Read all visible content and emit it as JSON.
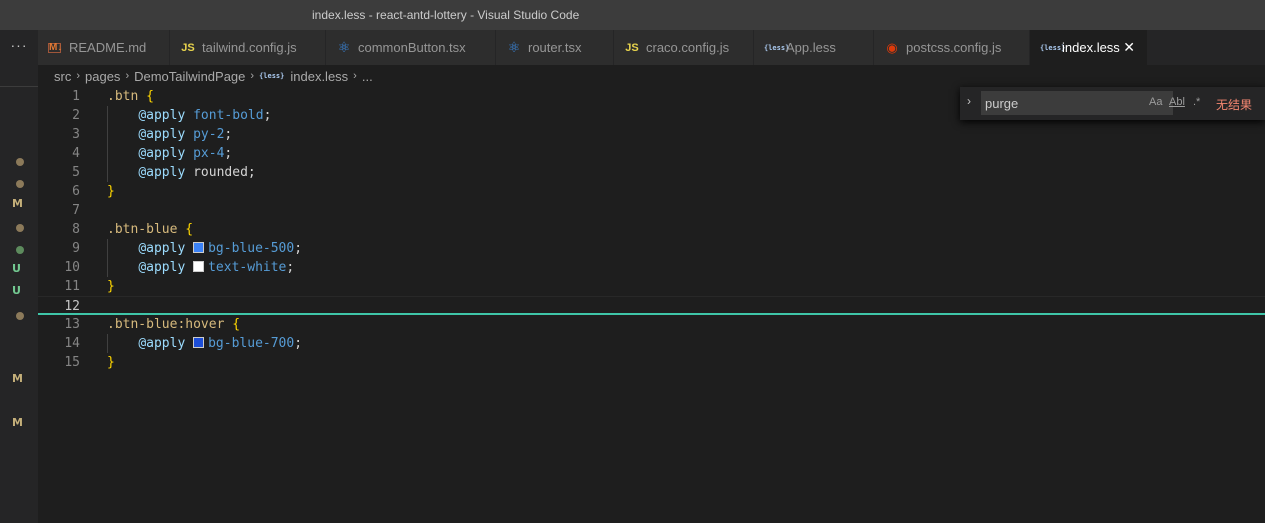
{
  "window": {
    "title": "index.less - react-antd-lottery - Visual Studio Code"
  },
  "tabbar": {
    "more_label": "···",
    "tabs": [
      {
        "label": "README.md",
        "icon": "markdown-icon",
        "icon_text": "M↓",
        "active": false
      },
      {
        "label": "tailwind.config.js",
        "icon": "javascript-icon",
        "icon_text": "JS",
        "active": false
      },
      {
        "label": "commonButton.tsx",
        "icon": "react-icon",
        "icon_text": "⚛",
        "active": false
      },
      {
        "label": "router.tsx",
        "icon": "react-icon",
        "icon_text": "⚛",
        "active": false
      },
      {
        "label": "craco.config.js",
        "icon": "javascript-icon",
        "icon_text": "JS",
        "active": false
      },
      {
        "label": "App.less",
        "icon": "less-icon",
        "icon_text": "{less}",
        "active": false
      },
      {
        "label": "postcss.config.js",
        "icon": "postcss-icon",
        "icon_text": "◉",
        "active": false
      },
      {
        "label": "index.less",
        "icon": "less-icon",
        "icon_text": "{less}",
        "active": true,
        "close": "✕"
      }
    ]
  },
  "breadcrumb": {
    "items": [
      "src",
      "pages",
      "DemoTailwindPage",
      "index.less",
      "..."
    ],
    "less_icon_text": "{less}",
    "separator": "›"
  },
  "sidebar_markers": [
    {
      "type": "dot",
      "label": ""
    },
    {
      "type": "dot",
      "label": ""
    },
    {
      "type": "letter",
      "label": "M"
    },
    {
      "type": "dot",
      "label": ""
    },
    {
      "type": "dotg",
      "label": ""
    },
    {
      "type": "letter",
      "label": "U"
    },
    {
      "type": "letter",
      "label": "U"
    },
    {
      "type": "dot",
      "label": ""
    },
    {
      "type": "letter",
      "label": "M"
    },
    {
      "type": "letter",
      "label": "M"
    }
  ],
  "editor": {
    "lines": [
      {
        "n": "1",
        "tokens": [
          [
            "sel",
            ".btn"
          ],
          [
            "plain",
            " "
          ],
          [
            "brace",
            "{"
          ]
        ]
      },
      {
        "n": "2",
        "tokens": [
          [
            "plain",
            "    "
          ],
          [
            "at",
            "@apply"
          ],
          [
            "plain",
            " "
          ],
          [
            "val",
            "font-bold"
          ],
          [
            "plain",
            ";"
          ]
        ]
      },
      {
        "n": "3",
        "tokens": [
          [
            "plain",
            "    "
          ],
          [
            "at",
            "@apply"
          ],
          [
            "plain",
            " "
          ],
          [
            "val",
            "py-2"
          ],
          [
            "plain",
            ";"
          ]
        ]
      },
      {
        "n": "4",
        "tokens": [
          [
            "plain",
            "    "
          ],
          [
            "at",
            "@apply"
          ],
          [
            "plain",
            " "
          ],
          [
            "val",
            "px-4"
          ],
          [
            "plain",
            ";"
          ]
        ]
      },
      {
        "n": "5",
        "tokens": [
          [
            "plain",
            "    "
          ],
          [
            "at",
            "@apply"
          ],
          [
            "plain",
            " rounded;"
          ]
        ]
      },
      {
        "n": "6",
        "tokens": [
          [
            "brace",
            "}"
          ]
        ]
      },
      {
        "n": "7",
        "tokens": []
      },
      {
        "n": "8",
        "tokens": [
          [
            "sel",
            ".btn-blue"
          ],
          [
            "plain",
            " "
          ],
          [
            "brace",
            "{"
          ]
        ]
      },
      {
        "n": "9",
        "tokens": [
          [
            "plain",
            "    "
          ],
          [
            "at",
            "@apply"
          ],
          [
            "plain",
            " "
          ],
          [
            "swatch",
            "#3b82f6"
          ],
          [
            "val",
            "bg-blue-500"
          ],
          [
            "plain",
            ";"
          ]
        ]
      },
      {
        "n": "10",
        "tokens": [
          [
            "plain",
            "    "
          ],
          [
            "at",
            "@apply"
          ],
          [
            "plain",
            " "
          ],
          [
            "swatch",
            "#ffffff"
          ],
          [
            "val",
            "text-white"
          ],
          [
            "plain",
            ";"
          ]
        ]
      },
      {
        "n": "11",
        "tokens": [
          [
            "brace",
            "}"
          ]
        ]
      },
      {
        "n": "12",
        "tokens": [],
        "current": true
      },
      {
        "n": "13",
        "tokens": [
          [
            "sel",
            ".btn-blue:hover"
          ],
          [
            "plain",
            " "
          ],
          [
            "brace",
            "{"
          ]
        ]
      },
      {
        "n": "14",
        "tokens": [
          [
            "plain",
            "    "
          ],
          [
            "at",
            "@apply"
          ],
          [
            "plain",
            " "
          ],
          [
            "swatch",
            "#1d4ed8"
          ],
          [
            "val",
            "bg-blue-700"
          ],
          [
            "plain",
            ";"
          ]
        ]
      },
      {
        "n": "15",
        "tokens": [
          [
            "brace",
            "}"
          ]
        ]
      }
    ]
  },
  "find_widget": {
    "toggle_icon": "›",
    "value": "purge",
    "match_case_label": "Aa",
    "whole_word_label": "Abl",
    "regex_label": ".*",
    "result_text": "无结果"
  },
  "colors": {
    "selector": "#d7ba7d",
    "brace": "#ffd700",
    "at_rule": "#9cdcfe",
    "value": "#569cd6",
    "current_line_border": "#3fc5a8",
    "no_result": "#f48771"
  }
}
